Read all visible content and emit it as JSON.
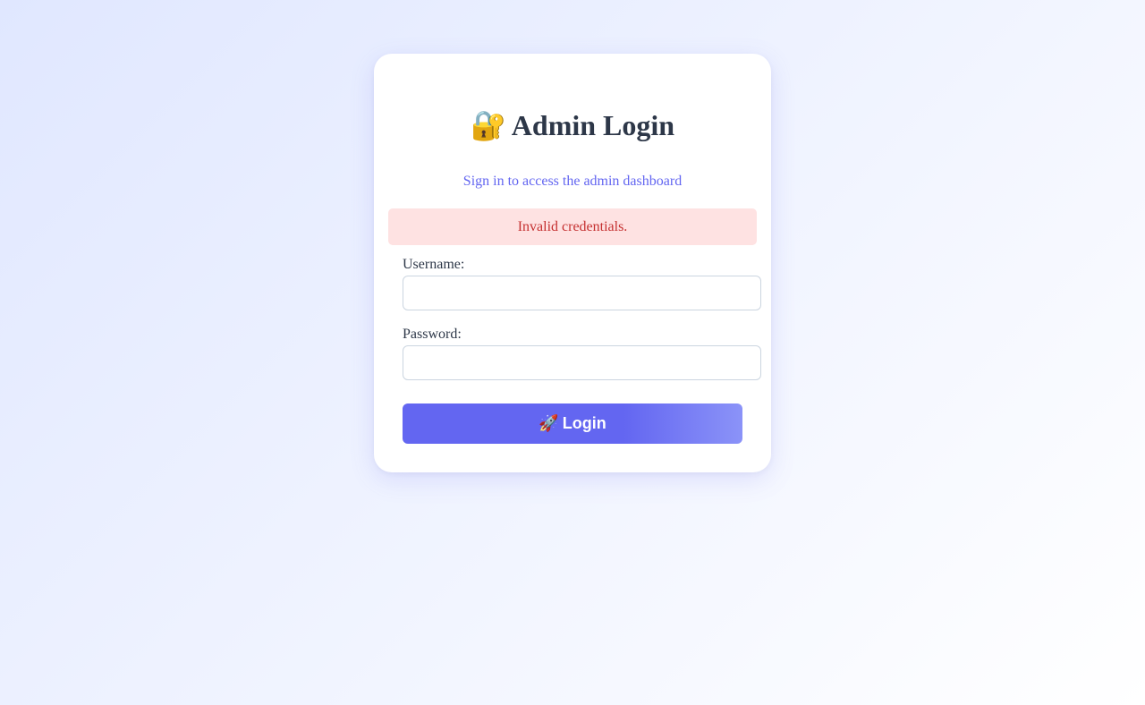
{
  "login": {
    "title_icon": "🔐",
    "title": "Admin Login",
    "subtitle": "Sign in to access the admin dashboard",
    "error": "Invalid credentials.",
    "username_label": "Username:",
    "username_value": "",
    "password_label": "Password:",
    "password_value": "",
    "button_icon": "🚀",
    "button_label": "Login"
  },
  "colors": {
    "accent": "#6366f1",
    "error_bg": "#fee2e2",
    "error_text": "#c53030",
    "heading": "#2d3748"
  },
  "icons": {
    "title_icon_name": "lock-with-key-icon",
    "button_icon_name": "rocket-icon"
  }
}
